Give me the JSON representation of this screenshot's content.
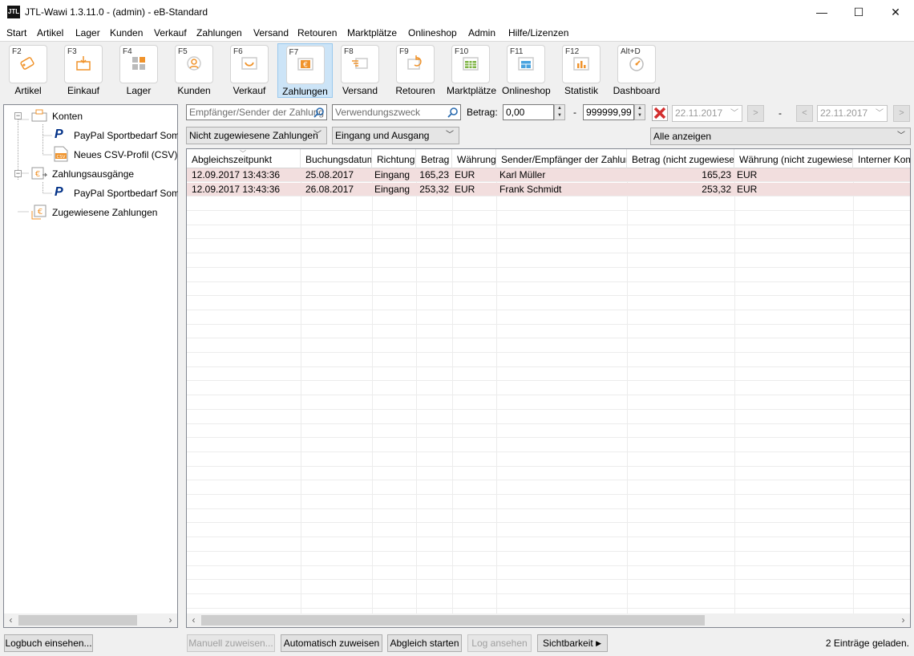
{
  "window": {
    "logo": "JTL",
    "title": "JTL-Wawi 1.3.11.0 - (admin) - eB-Standard",
    "minimize": "—",
    "maximize": "☐",
    "close": "✕"
  },
  "menu": [
    "Start",
    "Artikel",
    "Lager",
    "Kunden",
    "Verkauf",
    "Zahlungen",
    "Versand",
    "Retouren",
    "Marktplätze",
    "Onlineshop",
    "Admin",
    "Hilfe/Lizenzen"
  ],
  "toolbar": [
    {
      "key": "F2",
      "label": "Artikel",
      "icon": "tag-icon"
    },
    {
      "key": "F3",
      "label": "Einkauf",
      "icon": "box-download-icon"
    },
    {
      "key": "F4",
      "label": "Lager",
      "icon": "warehouse-icon"
    },
    {
      "key": "F5",
      "label": "Kunden",
      "icon": "customer-icon"
    },
    {
      "key": "F6",
      "label": "Verkauf",
      "icon": "cart-icon"
    },
    {
      "key": "F7",
      "label": "Zahlungen",
      "icon": "euro-payment-icon"
    },
    {
      "key": "F8",
      "label": "Versand",
      "icon": "shipping-icon"
    },
    {
      "key": "F9",
      "label": "Retouren",
      "icon": "return-icon"
    },
    {
      "key": "F10",
      "label": "Marktplätze",
      "icon": "marketplace-icon"
    },
    {
      "key": "F11",
      "label": "Onlineshop",
      "icon": "onlineshop-icon"
    },
    {
      "key": "F12",
      "label": "Statistik",
      "icon": "statistics-icon"
    },
    {
      "key": "Alt+D",
      "label": "Dashboard",
      "icon": "dashboard-icon"
    }
  ],
  "tree": {
    "konten": "Konten",
    "paypal1": "PayPal Sportbedarf Sommer",
    "csv": "Neues CSV-Profil (CSV)",
    "csv_badge": "CSV",
    "ausgaenge": "Zahlungsausgänge",
    "paypal2": "PayPal Sportbedarf Sommer",
    "zugewiesen": "Zugewiesene Zahlungen",
    "paypal_glyph": "P",
    "euro_glyph": "€"
  },
  "filters": {
    "sender_placeholder": "Empfänger/Sender der Zahlung",
    "purpose_placeholder": "Verwendungszweck",
    "amount_label": "Betrag:",
    "amount_from": "0,00",
    "dash": "-",
    "amount_to": "999999,99",
    "date_from": "22.11.2017",
    "date_to": "22.11.2017",
    "assignment": "Nicht zugewiesene Zahlungen",
    "direction": "Eingang und Ausgang",
    "show": "Alle anzeigen"
  },
  "grid": {
    "columns": [
      "Abgleichszeitpunkt",
      "Buchungsdatum",
      "Richtung",
      "Betrag",
      "Währung",
      "Sender/Empfänger der Zahlung",
      "Betrag (nicht zugewiesen)",
      "Währung (nicht zugewiesen)",
      "Interner Komm"
    ],
    "rows": [
      [
        "12.09.2017 13:43:36",
        "25.08.2017",
        "Eingang",
        "165,23",
        "EUR",
        "Karl Müller",
        "165,23",
        "EUR",
        ""
      ],
      [
        "12.09.2017 13:43:36",
        "26.08.2017",
        "Eingang",
        "253,32",
        "EUR",
        "Frank Schmidt",
        "253,32",
        "EUR",
        ""
      ]
    ]
  },
  "buttons": {
    "logbook": "Logbuch einsehen...",
    "manual": "Manuell zuweisen...",
    "auto": "Automatisch zuweisen",
    "start": "Abgleich starten",
    "log": "Log ansehen",
    "visibility": "Sichtbarkeit"
  },
  "status": "2 Einträge geladen.",
  "colors": {
    "accent": "#cce4f7",
    "row_highlight": "#f2dede",
    "orange": "#f0932b",
    "paypal": "#003087"
  }
}
